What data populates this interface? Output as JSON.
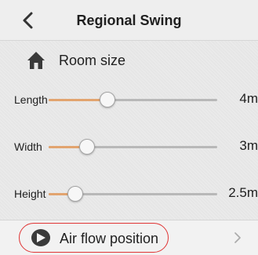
{
  "header": {
    "title": "Regional Swing",
    "back_icon": "chevron-left-icon"
  },
  "section": {
    "title": "Room size",
    "icon": "home-icon"
  },
  "sliders": [
    {
      "label": "Length",
      "value": "4m",
      "level": 0.35
    },
    {
      "label": "Width",
      "value": "3m",
      "level": 0.23
    },
    {
      "label": "Height",
      "value": "2.5m",
      "level": 0.16
    }
  ],
  "footer": {
    "label": "Air flow position",
    "icon": "air-flow-icon",
    "chevron_icon": "chevron-right-icon"
  },
  "colors": {
    "accent": "#e2a46f",
    "track": "#b8b8b8",
    "highlight": "#e03535"
  }
}
